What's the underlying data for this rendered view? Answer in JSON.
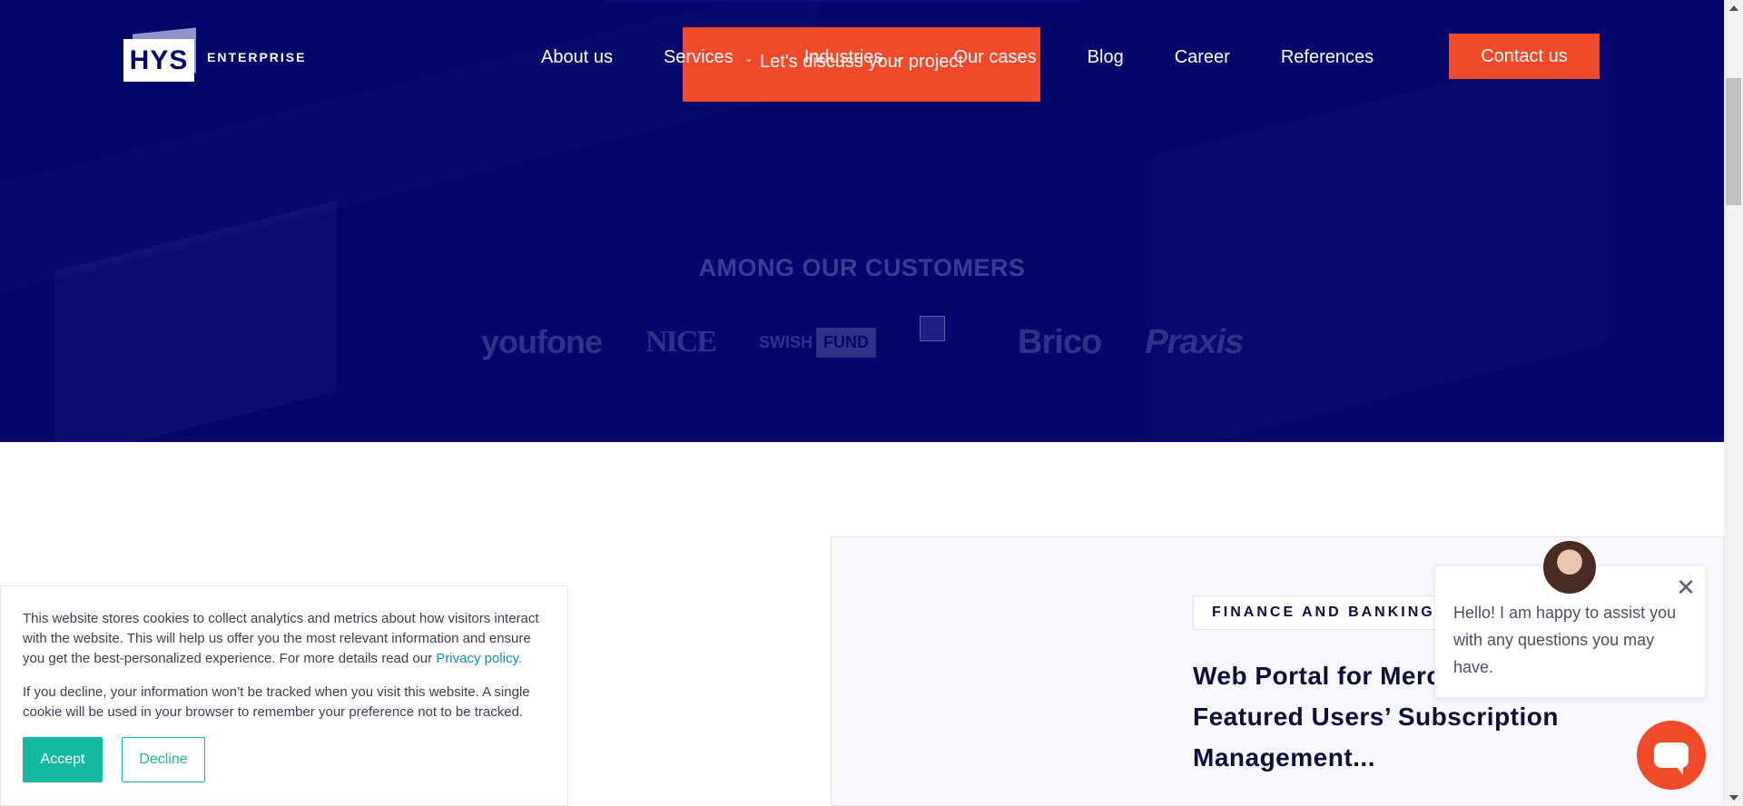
{
  "colors": {
    "hero_bg": "#03066b",
    "accent": "#f14a2b",
    "cookie_accent": "#15b8a0"
  },
  "logo": {
    "mark": "HYS",
    "sub": "ENTERPRISE"
  },
  "nav": {
    "items": [
      {
        "label": "About us"
      },
      {
        "label": "Services",
        "has_dropdown": true
      },
      {
        "label": "Industries",
        "has_dropdown": true
      },
      {
        "label": "Our cases"
      },
      {
        "label": "Blog"
      },
      {
        "label": "Career"
      },
      {
        "label": "References"
      }
    ],
    "contact_label": "Contact us"
  },
  "hero": {
    "cta_label": "Let's discuss your project"
  },
  "customers": {
    "title": "AMONG OUR CUSTOMERS",
    "logos": [
      "youfone",
      "NICE",
      "SWISH",
      "FUND",
      "Brico",
      "Praxis"
    ]
  },
  "case": {
    "tag": "FINANCE AND BANKING",
    "title": "Web Portal for Merc Full-Featured Users’ Subscription Management..."
  },
  "chat": {
    "message": "Hello! I am happy to assist you with any questions you may have.",
    "close_icon": "close-icon",
    "launcher_icon": "chat-bubble-icon"
  },
  "cookie": {
    "text1": "This website stores cookies to collect analytics and metrics about how visitors interact with the website. This will help us offer you the most relevant information and ensure you get the best-personalized experience. For more details read our ",
    "privacy_link": "Privacy policy.",
    "text2": "If you decline, your information won’t be tracked when you visit this website. A single cookie will be used in your browser to remember your preference not to be tracked.",
    "accept_label": "Accept",
    "decline_label": "Decline"
  }
}
